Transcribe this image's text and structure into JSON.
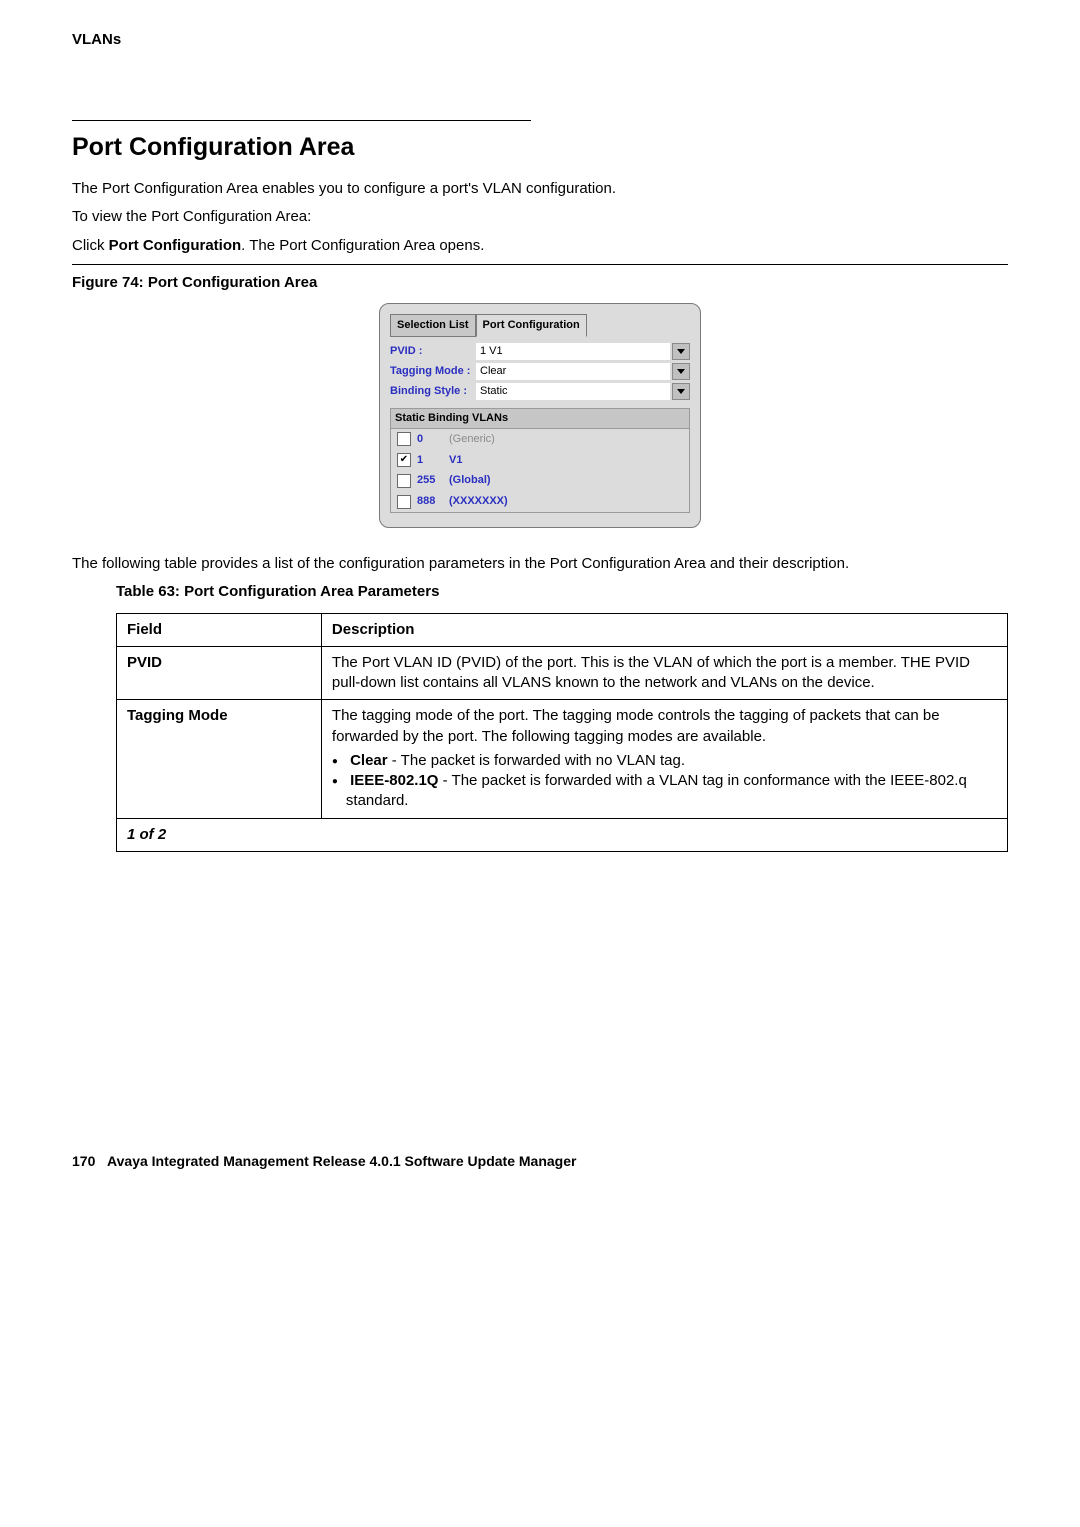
{
  "breadcrumb": "VLANs",
  "heading": "Port Configuration Area",
  "intro1": "The Port Configuration Area enables you to configure a port's VLAN configuration.",
  "intro2": "To view the Port Configuration Area:",
  "step_prefix": "Click ",
  "step_bold": "Port Configuration",
  "step_suffix": ". The Port Configuration Area opens.",
  "figure_caption": "Figure 74: Port Configuration Area",
  "ui": {
    "tabs": {
      "selection": "Selection List",
      "port_config": "Port Configuration"
    },
    "pvid_label": "PVID :",
    "pvid_value": "1    V1",
    "tagging_label": "Tagging Mode :",
    "tagging_value": "Clear",
    "binding_label": "Binding Style :",
    "binding_value": "Static",
    "group_title": "Static Binding VLANs",
    "rows": [
      {
        "checked": false,
        "id": "0",
        "name": "(Generic)",
        "disabled": true
      },
      {
        "checked": true,
        "id": "1",
        "name": "V1",
        "disabled": false
      },
      {
        "checked": false,
        "id": "255",
        "name": "(Global)",
        "disabled": false
      },
      {
        "checked": false,
        "id": "888",
        "name": "(XXXXXXX)",
        "disabled": false
      }
    ]
  },
  "after_figure": "The following table provides a list of the configuration parameters in the Port Configuration Area and their description.",
  "table_caption": "Table 63: Port Configuration Area Parameters",
  "table": {
    "head_field": "Field",
    "head_desc": "Description",
    "pvid_field": "PVID",
    "pvid_desc": "The Port VLAN ID (PVID) of the port. This is the VLAN of which the port is a member. THE PVID pull-down list contains all VLANS known to the network and VLANs on the device.",
    "tm_field": "Tagging Mode",
    "tm_desc_intro": "The tagging mode of the port. The tagging mode controls the tagging of packets that can be forwarded by the port. The following tagging modes are available.",
    "tm_b1_bold": "Clear",
    "tm_b1_rest": " - The packet is forwarded with no VLAN tag.",
    "tm_b2_bold": "IEEE-802.1Q",
    "tm_b2_rest": " - The packet is forwarded with a VLAN tag in conformance with the IEEE-802.q standard.",
    "page_indicator": "1 of 2"
  },
  "footer_page": "170",
  "footer_text": "Avaya Integrated Management Release 4.0.1 Software Update Manager"
}
